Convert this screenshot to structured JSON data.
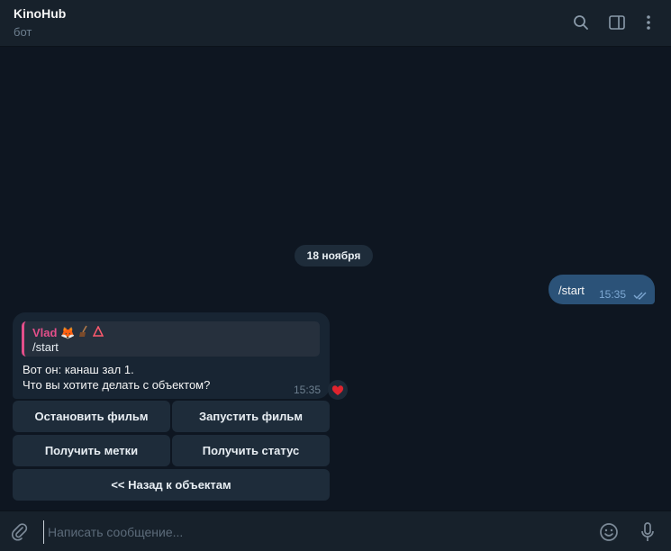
{
  "header": {
    "title": "KinoHub",
    "subtitle": "бот",
    "icons": [
      "search-icon",
      "sidebar-toggle-icon",
      "more-icon"
    ]
  },
  "chat": {
    "date_separator": "18 ноября",
    "outgoing": {
      "text": "/start",
      "time": "15:35",
      "status": "read"
    },
    "incoming": {
      "reply_name": "Vlad 🦊",
      "reply_text": "/start",
      "line1": "Вот он: канаш зал 1.",
      "line2": "Что вы хотите делать с объектом?",
      "time": "15:35",
      "reaction": "heart"
    },
    "keyboard": {
      "stop_film": "Остановить фильм",
      "start_film": "Запустить фильм",
      "get_marks": "Получить метки",
      "get_status": "Получить статус",
      "back": "<< Назад к объектам"
    }
  },
  "composer": {
    "placeholder": "Написать сообщение...",
    "value": ""
  },
  "colors": {
    "background": "#0e1621",
    "panel": "#17212b",
    "outgoing_bubble": "#2b5278",
    "incoming_bubble": "#182533",
    "reply_accent": "#e34f8a"
  }
}
